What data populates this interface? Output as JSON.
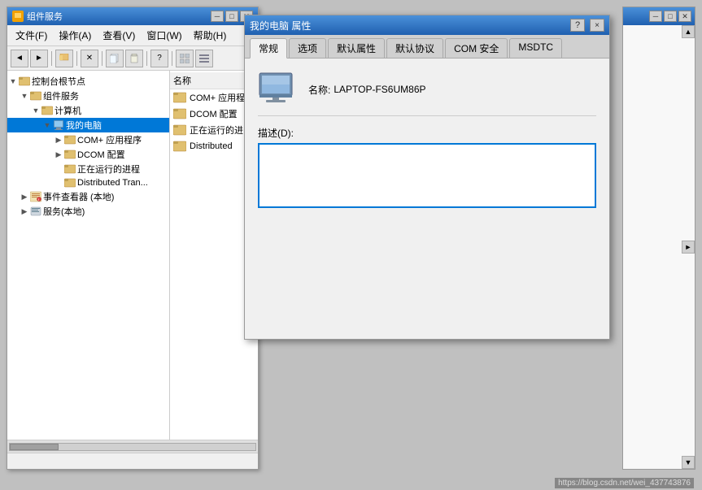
{
  "compServicesWindow": {
    "title": "组件服务",
    "menuItems": [
      "文件(F)",
      "操作(A)",
      "查看(V)",
      "窗口(W)",
      "帮助(H)"
    ],
    "treeItems": [
      {
        "label": "控制台根节点",
        "level": 0,
        "expandable": true,
        "expanded": true
      },
      {
        "label": "组件服务",
        "level": 1,
        "expandable": true,
        "expanded": true
      },
      {
        "label": "计算机",
        "level": 2,
        "expandable": true,
        "expanded": true
      },
      {
        "label": "我的电脑",
        "level": 3,
        "expandable": true,
        "expanded": true,
        "selected": false
      },
      {
        "label": "COM+ 应用程序",
        "level": 4,
        "expandable": true,
        "expanded": false
      },
      {
        "label": "DCOM 配置",
        "level": 4,
        "expandable": true,
        "expanded": false
      },
      {
        "label": "正在运行的进程",
        "level": 4,
        "expandable": false,
        "expanded": false
      },
      {
        "label": "Distributed Tran...",
        "level": 4,
        "expandable": false,
        "expanded": false
      },
      {
        "label": "事件查看器 (本地)",
        "level": 1,
        "expandable": true,
        "expanded": false
      },
      {
        "label": "服务(本地)",
        "level": 1,
        "expandable": true,
        "expanded": false
      }
    ],
    "listItems": [
      {
        "label": "COM+ 应用程序"
      },
      {
        "label": "DCOM 配置"
      },
      {
        "label": "正在运行的进..."
      },
      {
        "label": "Distributed"
      }
    ],
    "listHeader": "名称"
  },
  "dialog": {
    "title": "我的电脑 属性",
    "tabs": [
      "常规",
      "选项",
      "默认属性",
      "默认协议",
      "COM 安全",
      "MSDTC"
    ],
    "activeTab": "常规",
    "computerIcon": "computer",
    "nameLabel": "名称:",
    "nameValue": "LAPTOP-FS6UM86P",
    "descLabel": "描述(D):",
    "descValue": "",
    "helpBtn": "?",
    "closeBtn": "×"
  },
  "rightPanel": {
    "scrollUpLabel": "▲",
    "scrollDownLabel": "▼"
  },
  "watermark": "https://blog.csdn.net/wei_437743876"
}
